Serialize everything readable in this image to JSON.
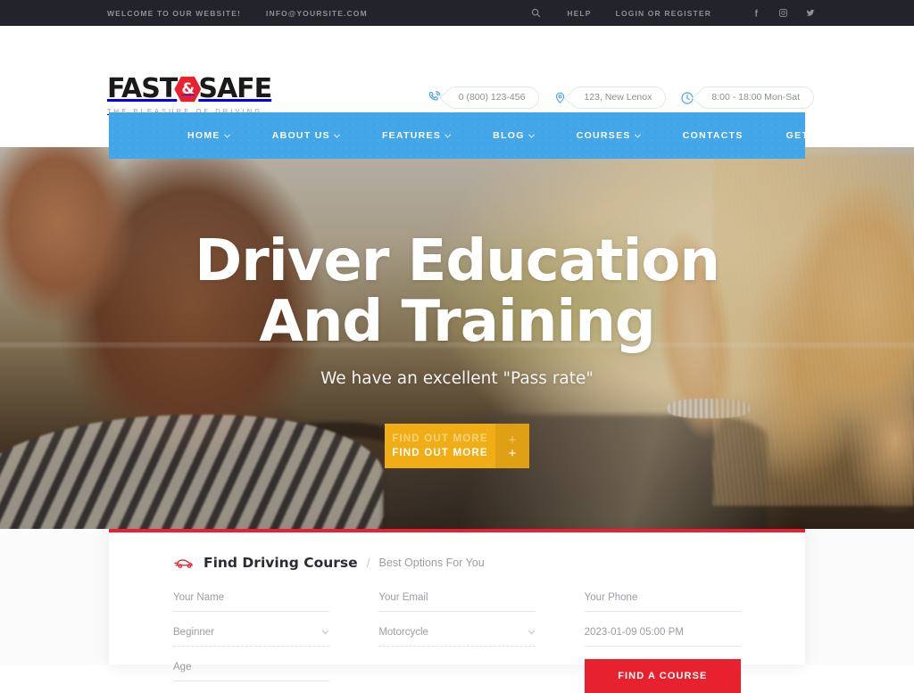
{
  "topbar": {
    "welcome": "WELCOME TO OUR WEBSITE!",
    "email": "INFO@YOURSITE.COM",
    "search_icon": "search-icon",
    "help": "HELP",
    "login": "LOGIN OR REGISTER",
    "social": [
      {
        "name": "facebook-icon",
        "label": "Facebook"
      },
      {
        "name": "instagram-icon",
        "label": "Instagram"
      },
      {
        "name": "twitter-icon",
        "label": "Twitter"
      }
    ]
  },
  "header": {
    "logo": {
      "part1": "FAST",
      "amp": "&",
      "part2": "SAFE",
      "tagline": "THE PLEASURE OF DRIVING"
    },
    "contacts": [
      {
        "icon": "phone-icon",
        "value": "0 (800) 123-456"
      },
      {
        "icon": "map-pin-icon",
        "value": "123, New Lenox"
      },
      {
        "icon": "clock-icon",
        "value": "8:00 - 18:00 Mon-Sat"
      }
    ]
  },
  "nav": {
    "items": [
      {
        "label": "HOME",
        "dropdown": true
      },
      {
        "label": "ABOUT US",
        "dropdown": true
      },
      {
        "label": "FEATURES",
        "dropdown": true
      },
      {
        "label": "BLOG",
        "dropdown": true
      },
      {
        "label": "COURSES",
        "dropdown": true
      },
      {
        "label": "CONTACTS",
        "dropdown": false
      },
      {
        "label": "GET STARTED!",
        "dropdown": false
      }
    ]
  },
  "hero": {
    "title_line1": "Driver Education",
    "title_line2": "And Training",
    "subtitle": "We have an excellent \"Pass rate\"",
    "cta_label": "FIND OUT MORE",
    "cta_icon": "plus-icon"
  },
  "form": {
    "icon": "car-icon",
    "title": "Find Driving Course",
    "separator": "/",
    "subtitle": "Best Options For You",
    "fields": {
      "name_placeholder": "Your Name",
      "email_placeholder": "Your Email",
      "phone_placeholder": "Your Phone",
      "level_value": "Beginner",
      "vehicle_value": "Motorcycle",
      "datetime_value": "2023-01-09 05:00 PM",
      "age_placeholder": "Age"
    },
    "submit_label": "FIND A COURSE"
  },
  "colors": {
    "brand_red": "#e8212e",
    "nav_blue": "#43a6e8",
    "cta_yellow": "#f0ad16",
    "topbar_dark": "#22232b"
  }
}
